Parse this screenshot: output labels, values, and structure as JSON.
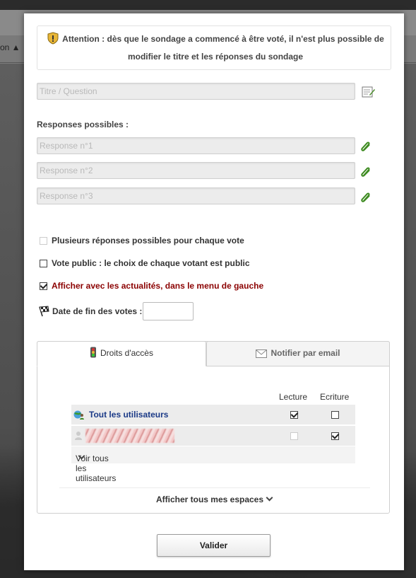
{
  "background": {
    "label": "on ▲"
  },
  "warning": {
    "icon": "shield-warning-icon",
    "text": "Attention : dès que le sondage a commencé à être voté, il n'est plus possible de modifier le titre et les réponses du sondage"
  },
  "title_field": {
    "placeholder": "Titre / Question",
    "icon": "edit-note-icon"
  },
  "responses": {
    "label": "Responses possibles :",
    "items": [
      {
        "placeholder": "Response n°1",
        "icon": "paperclip-icon"
      },
      {
        "placeholder": "Response n°2",
        "icon": "paperclip-icon"
      },
      {
        "placeholder": "Response n°3",
        "icon": "paperclip-icon"
      }
    ]
  },
  "options": {
    "multiple": {
      "label": "Plusieurs réponses possibles pour chaque vote",
      "checked": false,
      "disabled": true
    },
    "public_vote": {
      "label": "Vote public : le choix de chaque votant est public",
      "checked": false
    },
    "show_news": {
      "label": "Afficher avec les actualités, dans le menu de gauche",
      "checked": true
    },
    "end_date": {
      "label": "Date de fin des votes :",
      "value": "",
      "icon": "checkered-flag-icon"
    }
  },
  "tabs": {
    "access": {
      "label": "Droits d'accès",
      "icon": "traffic-light-icon"
    },
    "notify": {
      "label": "Notifier par email",
      "icon": "envelope-icon"
    }
  },
  "permissions": {
    "headers": {
      "read": "Lecture",
      "write": "Ecriture"
    },
    "rows": [
      {
        "name": "Tout les utilisateurs",
        "icon": "users-group-icon",
        "read": true,
        "write": false
      },
      {
        "name": "",
        "icon": "user-icon",
        "read": false,
        "write": true,
        "redacted": true
      }
    ],
    "show_all_users": "Voir tous les utilisateurs",
    "show_all_spaces": "Afficher tous mes espaces"
  },
  "submit_label": "Valider"
}
